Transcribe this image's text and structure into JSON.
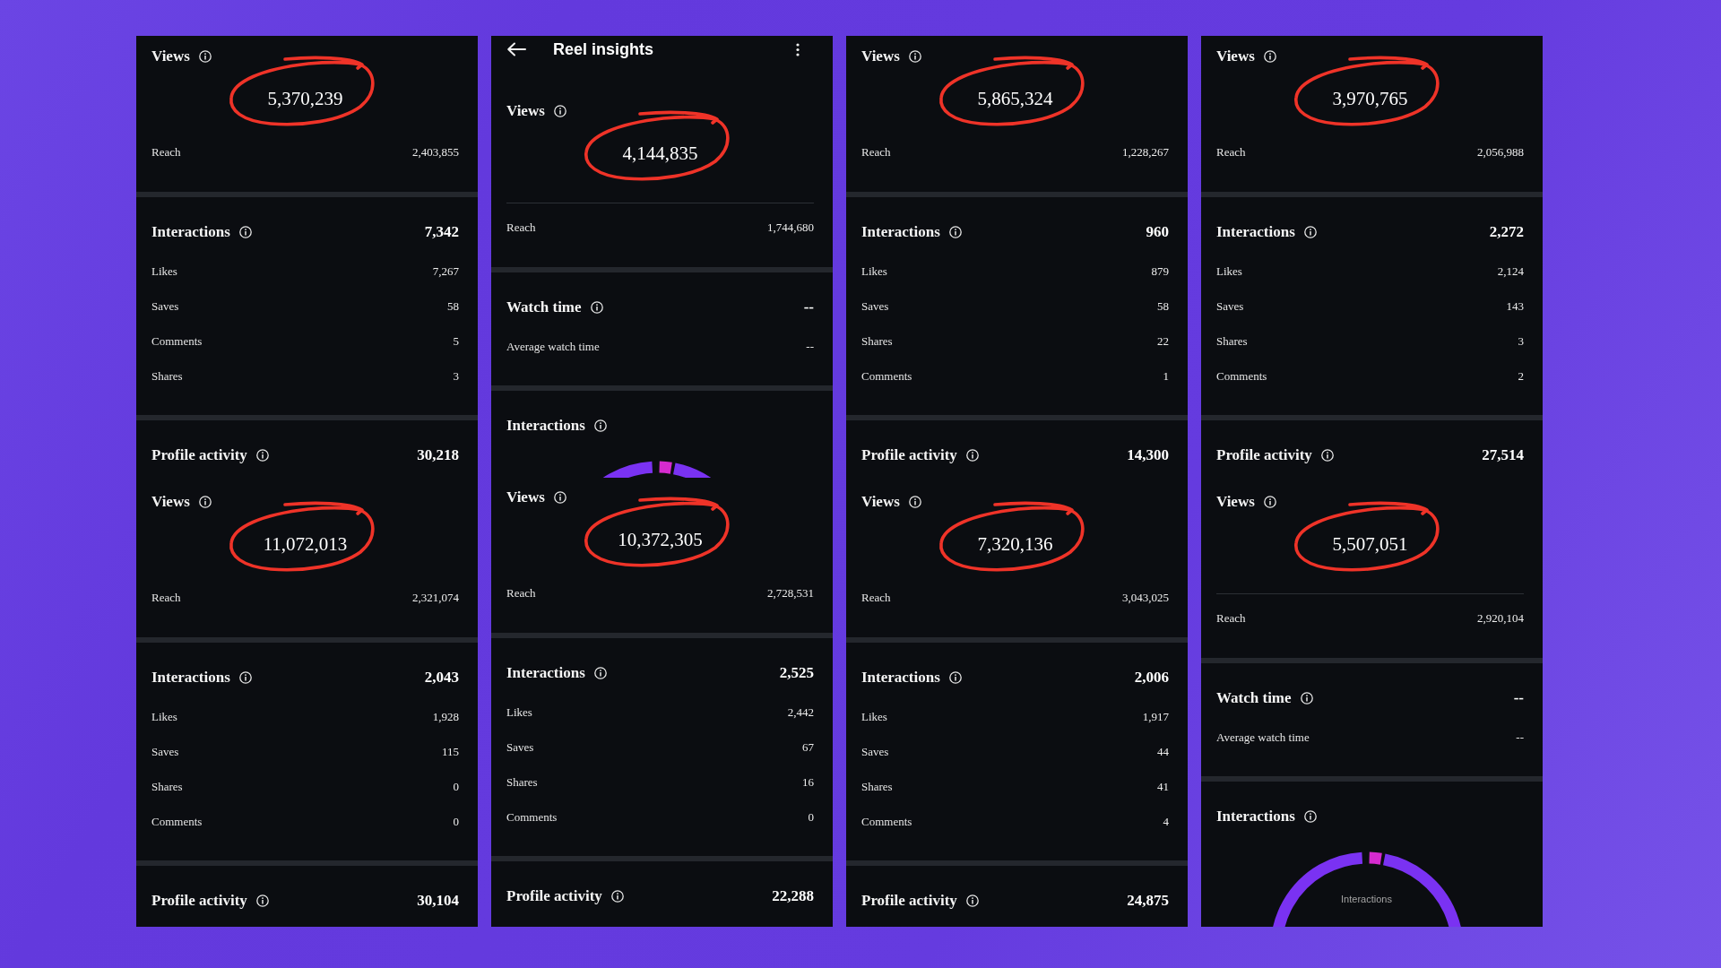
{
  "panels": [
    {
      "cards": [
        {
          "blocks": [
            {
              "kind": "views",
              "label": "Views",
              "value": "5,370,239",
              "circled": true,
              "reach": {
                "label": "Reach",
                "value": "2,403,855"
              }
            }
          ]
        },
        {
          "blocks": [
            {
              "kind": "metric",
              "label": "Interactions",
              "value": "7,342",
              "rows": [
                {
                  "label": "Likes",
                  "value": "7,267"
                },
                {
                  "label": "Saves",
                  "value": "58"
                },
                {
                  "label": "Comments",
                  "value": "5"
                },
                {
                  "label": "Shares",
                  "value": "3"
                }
              ]
            }
          ]
        },
        {
          "blocks": [
            {
              "kind": "metric",
              "label": "Profile activity",
              "value": "30,218"
            },
            {
              "kind": "views",
              "label": "Views",
              "value": "11,072,013",
              "circled": true,
              "reach": {
                "label": "Reach",
                "value": "2,321,074"
              }
            }
          ]
        },
        {
          "blocks": [
            {
              "kind": "metric",
              "label": "Interactions",
              "value": "2,043",
              "rows": [
                {
                  "label": "Likes",
                  "value": "1,928"
                },
                {
                  "label": "Saves",
                  "value": "115"
                },
                {
                  "label": "Shares",
                  "value": "0"
                },
                {
                  "label": "Comments",
                  "value": "0"
                }
              ]
            }
          ]
        },
        {
          "blocks": [
            {
              "kind": "metric",
              "label": "Profile activity",
              "value": "30,104"
            }
          ]
        }
      ]
    },
    {
      "app_bar": {
        "title": "Reel insights"
      },
      "cards": [
        {
          "blocks": [
            {
              "kind": "views",
              "label": "Views",
              "value": "4,144,835",
              "circled": true,
              "rule": true,
              "reach": {
                "label": "Reach",
                "value": "1,744,680"
              }
            }
          ]
        },
        {
          "blocks": [
            {
              "kind": "metric",
              "label": "Watch time",
              "value": "--",
              "rows": [
                {
                  "label": "Average watch time",
                  "value": "--"
                }
              ]
            }
          ]
        },
        {
          "blocks": [
            {
              "kind": "donut",
              "label": "Interactions"
            },
            {
              "kind": "views",
              "label": "Views",
              "value": "10,372,305",
              "circled": true,
              "reach": {
                "label": "Reach",
                "value": "2,728,531"
              }
            }
          ]
        },
        {
          "blocks": [
            {
              "kind": "metric",
              "label": "Interactions",
              "value": "2,525",
              "rows": [
                {
                  "label": "Likes",
                  "value": "2,442"
                },
                {
                  "label": "Saves",
                  "value": "67"
                },
                {
                  "label": "Shares",
                  "value": "16"
                },
                {
                  "label": "Comments",
                  "value": "0"
                }
              ]
            }
          ]
        },
        {
          "blocks": [
            {
              "kind": "metric",
              "label": "Profile activity",
              "value": "22,288"
            }
          ]
        }
      ]
    },
    {
      "cards": [
        {
          "blocks": [
            {
              "kind": "views",
              "label": "Views",
              "value": "5,865,324",
              "circled": true,
              "reach": {
                "label": "Reach",
                "value": "1,228,267"
              }
            }
          ]
        },
        {
          "blocks": [
            {
              "kind": "metric",
              "label": "Interactions",
              "value": "960",
              "rows": [
                {
                  "label": "Likes",
                  "value": "879"
                },
                {
                  "label": "Saves",
                  "value": "58"
                },
                {
                  "label": "Shares",
                  "value": "22"
                },
                {
                  "label": "Comments",
                  "value": "1"
                }
              ]
            }
          ]
        },
        {
          "blocks": [
            {
              "kind": "metric",
              "label": "Profile activity",
              "value": "14,300"
            },
            {
              "kind": "views",
              "label": "Views",
              "value": "7,320,136",
              "circled": true,
              "reach": {
                "label": "Reach",
                "value": "3,043,025"
              }
            }
          ]
        },
        {
          "blocks": [
            {
              "kind": "metric",
              "label": "Interactions",
              "value": "2,006",
              "rows": [
                {
                  "label": "Likes",
                  "value": "1,917"
                },
                {
                  "label": "Saves",
                  "value": "44"
                },
                {
                  "label": "Shares",
                  "value": "41"
                },
                {
                  "label": "Comments",
                  "value": "4"
                }
              ]
            }
          ]
        },
        {
          "blocks": [
            {
              "kind": "metric",
              "label": "Profile activity",
              "value": "24,875"
            }
          ]
        }
      ]
    },
    {
      "cards": [
        {
          "blocks": [
            {
              "kind": "views",
              "label": "Views",
              "value": "3,970,765",
              "circled": true,
              "reach": {
                "label": "Reach",
                "value": "2,056,988"
              }
            }
          ]
        },
        {
          "blocks": [
            {
              "kind": "metric",
              "label": "Interactions",
              "value": "2,272",
              "rows": [
                {
                  "label": "Likes",
                  "value": "2,124"
                },
                {
                  "label": "Saves",
                  "value": "143"
                },
                {
                  "label": "Shares",
                  "value": "3"
                },
                {
                  "label": "Comments",
                  "value": "2"
                }
              ]
            }
          ]
        },
        {
          "blocks": [
            {
              "kind": "metric",
              "label": "Profile activity",
              "value": "27,514"
            },
            {
              "kind": "views",
              "label": "Views",
              "value": "5,507,051",
              "circled": true,
              "rule": true,
              "reach": {
                "label": "Reach",
                "value": "2,920,104"
              }
            }
          ]
        },
        {
          "blocks": [
            {
              "kind": "metric",
              "label": "Watch time",
              "value": "--",
              "rows": [
                {
                  "label": "Average watch time",
                  "value": "--"
                }
              ]
            }
          ]
        },
        {
          "blocks": [
            {
              "kind": "donut",
              "label": "Interactions",
              "center_label": "Interactions"
            }
          ]
        }
      ]
    }
  ]
}
